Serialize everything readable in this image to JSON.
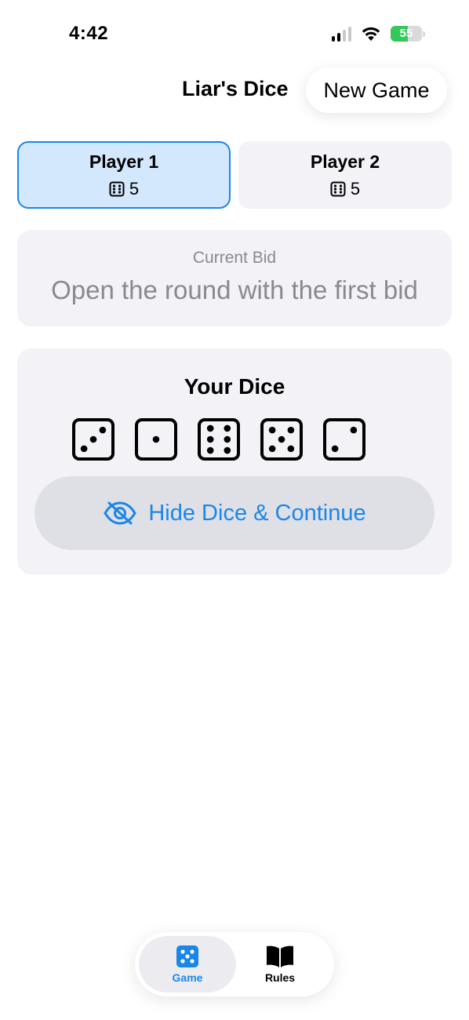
{
  "status": {
    "time": "4:42",
    "battery": "55",
    "battery_percent": 55
  },
  "header": {
    "title": "Liar's Dice",
    "new_game_label": "New Game"
  },
  "players": [
    {
      "name": "Player 1",
      "dice_count": "5",
      "active": true
    },
    {
      "name": "Player 2",
      "dice_count": "5",
      "active": false
    }
  ],
  "bid": {
    "label": "Current Bid",
    "text": "Open the round with the first bid"
  },
  "dice": {
    "title": "Your Dice",
    "values": [
      3,
      1,
      6,
      5,
      2
    ],
    "hide_label": "Hide Dice & Continue"
  },
  "tabs": [
    {
      "label": "Game",
      "icon": "dice-icon",
      "active": true
    },
    {
      "label": "Rules",
      "icon": "book-icon",
      "active": false
    }
  ],
  "colors": {
    "accent": "#1a86e8",
    "active_card_bg": "#d4e8fd",
    "card_bg": "#f2f2f7",
    "battery": "#35c759"
  }
}
